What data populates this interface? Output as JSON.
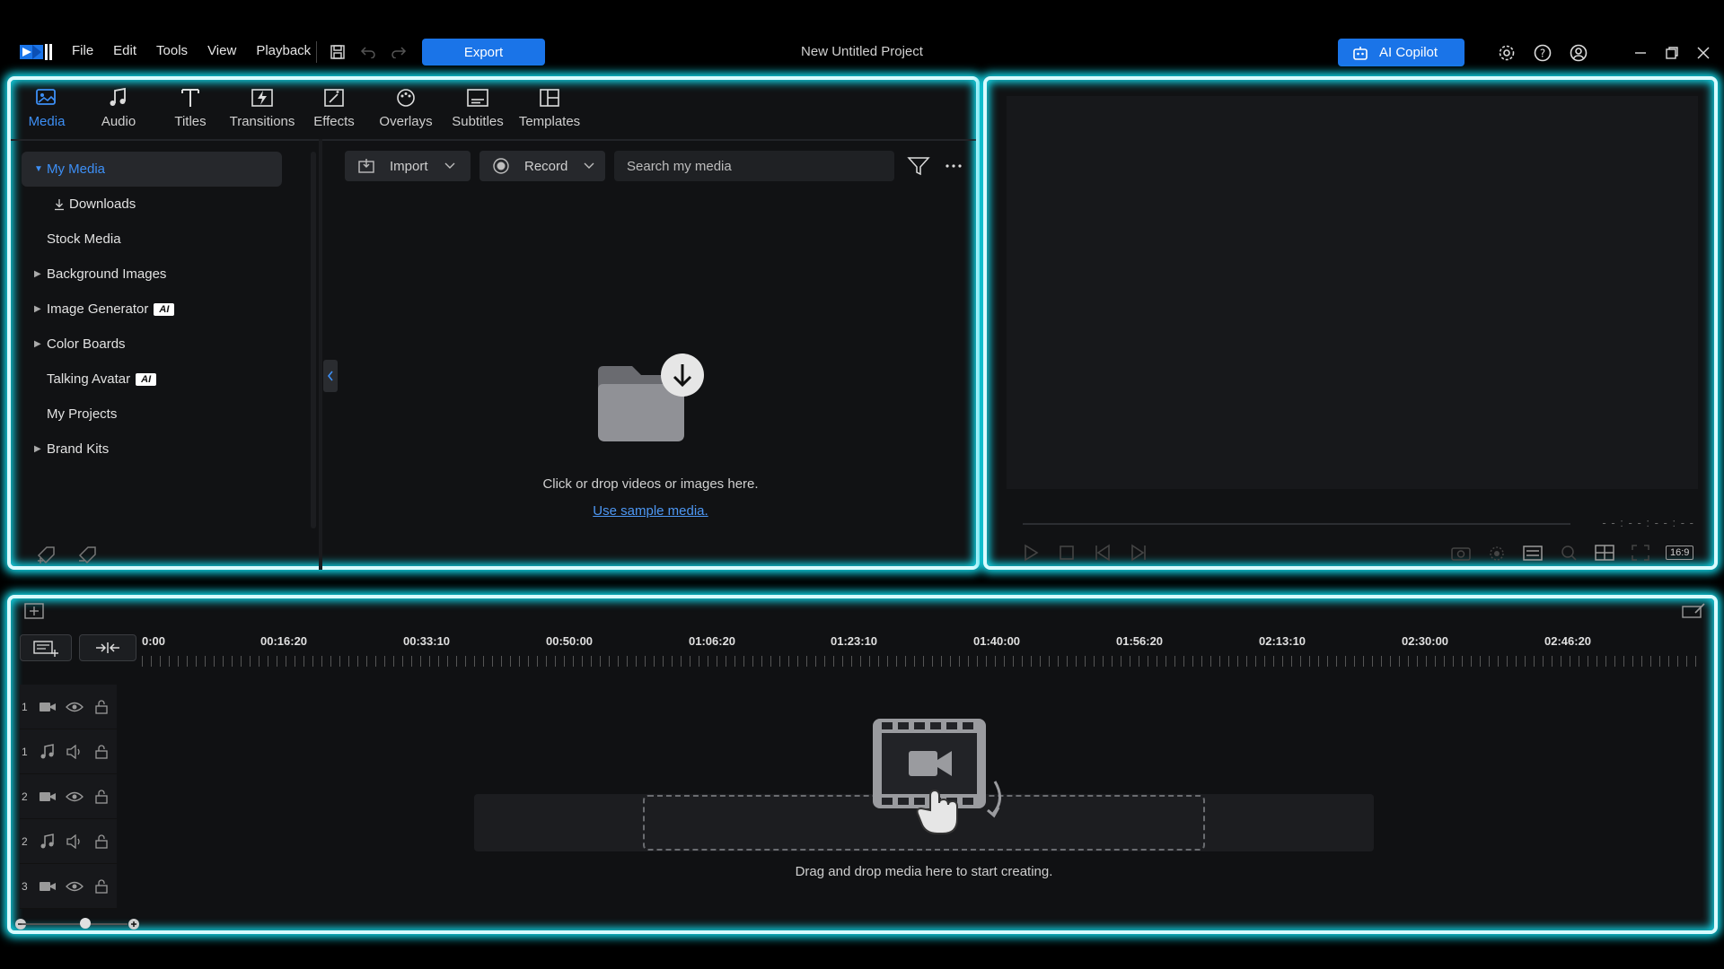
{
  "app": {
    "project_title": "New Untitled Project",
    "menu": [
      "File",
      "Edit",
      "Tools",
      "View",
      "Playback"
    ],
    "export_label": "Export",
    "copilot_label": "AI Copilot"
  },
  "media_tabs": [
    {
      "label": "Media",
      "icon": "media-icon",
      "active": true
    },
    {
      "label": "Audio",
      "icon": "music-note-icon"
    },
    {
      "label": "Titles",
      "icon": "text-icon"
    },
    {
      "label": "Transitions",
      "icon": "transition-icon"
    },
    {
      "label": "Effects",
      "icon": "effects-icon"
    },
    {
      "label": "Overlays",
      "icon": "overlays-icon"
    },
    {
      "label": "Subtitles",
      "icon": "subtitles-icon"
    },
    {
      "label": "Templates",
      "icon": "templates-icon"
    }
  ],
  "sidebar": {
    "items": [
      {
        "label": "My Media",
        "expandable": true,
        "expanded": true,
        "selected": true
      },
      {
        "label": "Downloads",
        "icon": "download-icon",
        "indent": true
      },
      {
        "label": "Stock Media"
      },
      {
        "label": "Background Images",
        "expandable": true
      },
      {
        "label": "Image Generator",
        "expandable": true,
        "badge": "AI"
      },
      {
        "label": "Color Boards",
        "expandable": true
      },
      {
        "label": "Talking Avatar",
        "badge": "AI"
      },
      {
        "label": "My Projects"
      },
      {
        "label": "Brand Kits",
        "expandable": true
      }
    ]
  },
  "media_toolbar": {
    "import_label": "Import",
    "record_label": "Record",
    "search_placeholder": "Search my media"
  },
  "media_empty": {
    "message": "Click or drop videos or images here.",
    "link": "Use sample media."
  },
  "preview": {
    "timecode": "- - : - - : - - : - -",
    "aspect_ratio": "16:9"
  },
  "timeline": {
    "ruler_labels": [
      "0:00",
      "00:16:20",
      "00:33:10",
      "00:50:00",
      "01:06:20",
      "01:23:10",
      "01:40:00",
      "01:56:20",
      "02:13:10",
      "02:30:00",
      "02:46:20"
    ],
    "tracks": [
      {
        "num": "1",
        "type": "video"
      },
      {
        "num": "1",
        "type": "audio"
      },
      {
        "num": "2",
        "type": "video"
      },
      {
        "num": "2",
        "type": "audio"
      },
      {
        "num": "3",
        "type": "video"
      }
    ],
    "drop_message": "Drag and drop media here to start creating.",
    "zoom_level": 0.6
  },
  "colors": {
    "accent": "#1a74e8",
    "active_text": "#3d8ff5",
    "glow": "#12d7e8"
  }
}
